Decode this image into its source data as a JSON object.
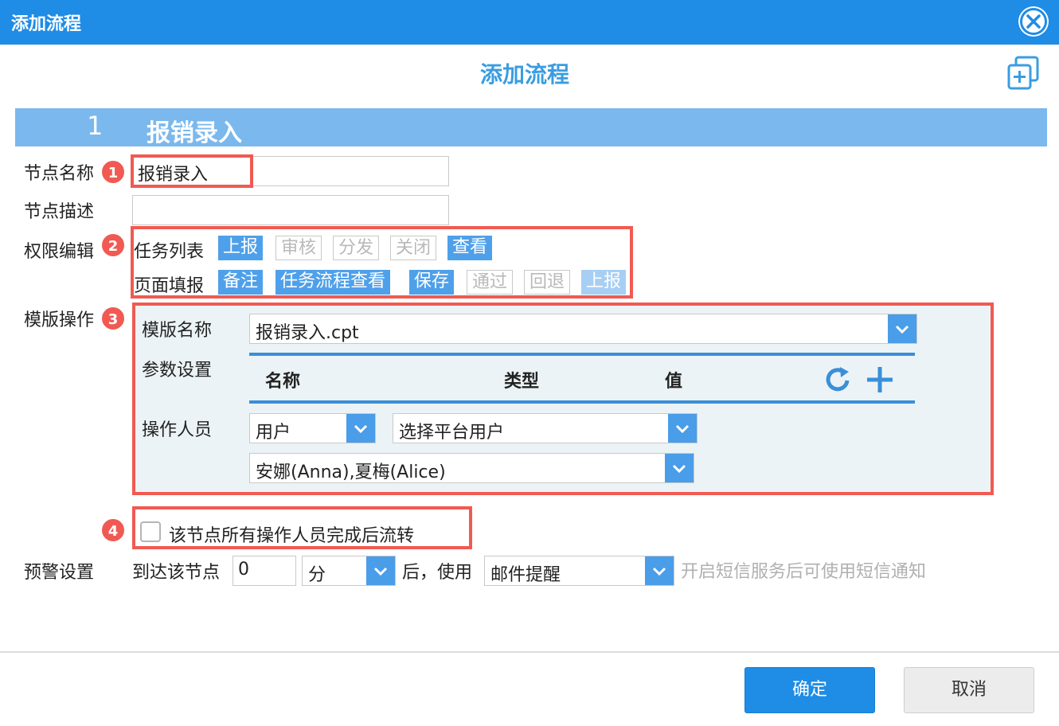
{
  "window": {
    "title": "添加流程"
  },
  "header": {
    "title": "添加流程"
  },
  "section": {
    "number": "1",
    "name": "报销录入"
  },
  "labels": {
    "node_name": "节点名称",
    "node_desc": "节点描述",
    "perm_edit": "权限编辑",
    "template_op": "模版操作",
    "template_name": "模版名称",
    "param_settings": "参数设置",
    "operators": "操作人员",
    "warning_settings": "预警设置",
    "arrive_node": "到达该节点",
    "after_use": "后，使用"
  },
  "node": {
    "name_value": "报销录入",
    "desc_value": ""
  },
  "badges": [
    "1",
    "2",
    "3",
    "4"
  ],
  "permissions": {
    "task_list": {
      "label": "任务列表",
      "items": [
        {
          "label": "上报",
          "state": "on"
        },
        {
          "label": "审核",
          "state": "off"
        },
        {
          "label": "分发",
          "state": "off"
        },
        {
          "label": "关闭",
          "state": "off"
        },
        {
          "label": "查看",
          "state": "on"
        }
      ]
    },
    "page_fill": {
      "label": "页面填报",
      "items": [
        {
          "label": "备注",
          "state": "on"
        },
        {
          "label": "任务流程查看",
          "state": "on"
        },
        {
          "label": "保存",
          "state": "on"
        },
        {
          "label": "通过",
          "state": "off"
        },
        {
          "label": "回退",
          "state": "off"
        },
        {
          "label": "上报",
          "state": "dim"
        }
      ]
    }
  },
  "template": {
    "name_value": "报销录入.cpt",
    "param_columns": [
      "名称",
      "类型",
      "值"
    ],
    "operator_type": "用户",
    "operator_source": "选择平台用户",
    "operator_users": "安娜(Anna),夏梅(Alice)"
  },
  "flow_option": {
    "label": "该节点所有操作人员完成后流转",
    "checked": false
  },
  "warning": {
    "value": "0",
    "unit": "分",
    "method": "邮件提醒",
    "hint": "开启短信服务后可使用短信通知"
  },
  "buttons": {
    "confirm": "确定",
    "cancel": "取消"
  },
  "colors": {
    "accent": "#1f8ce6",
    "highlight": "#f05a52",
    "section": "#7ab8ee"
  }
}
